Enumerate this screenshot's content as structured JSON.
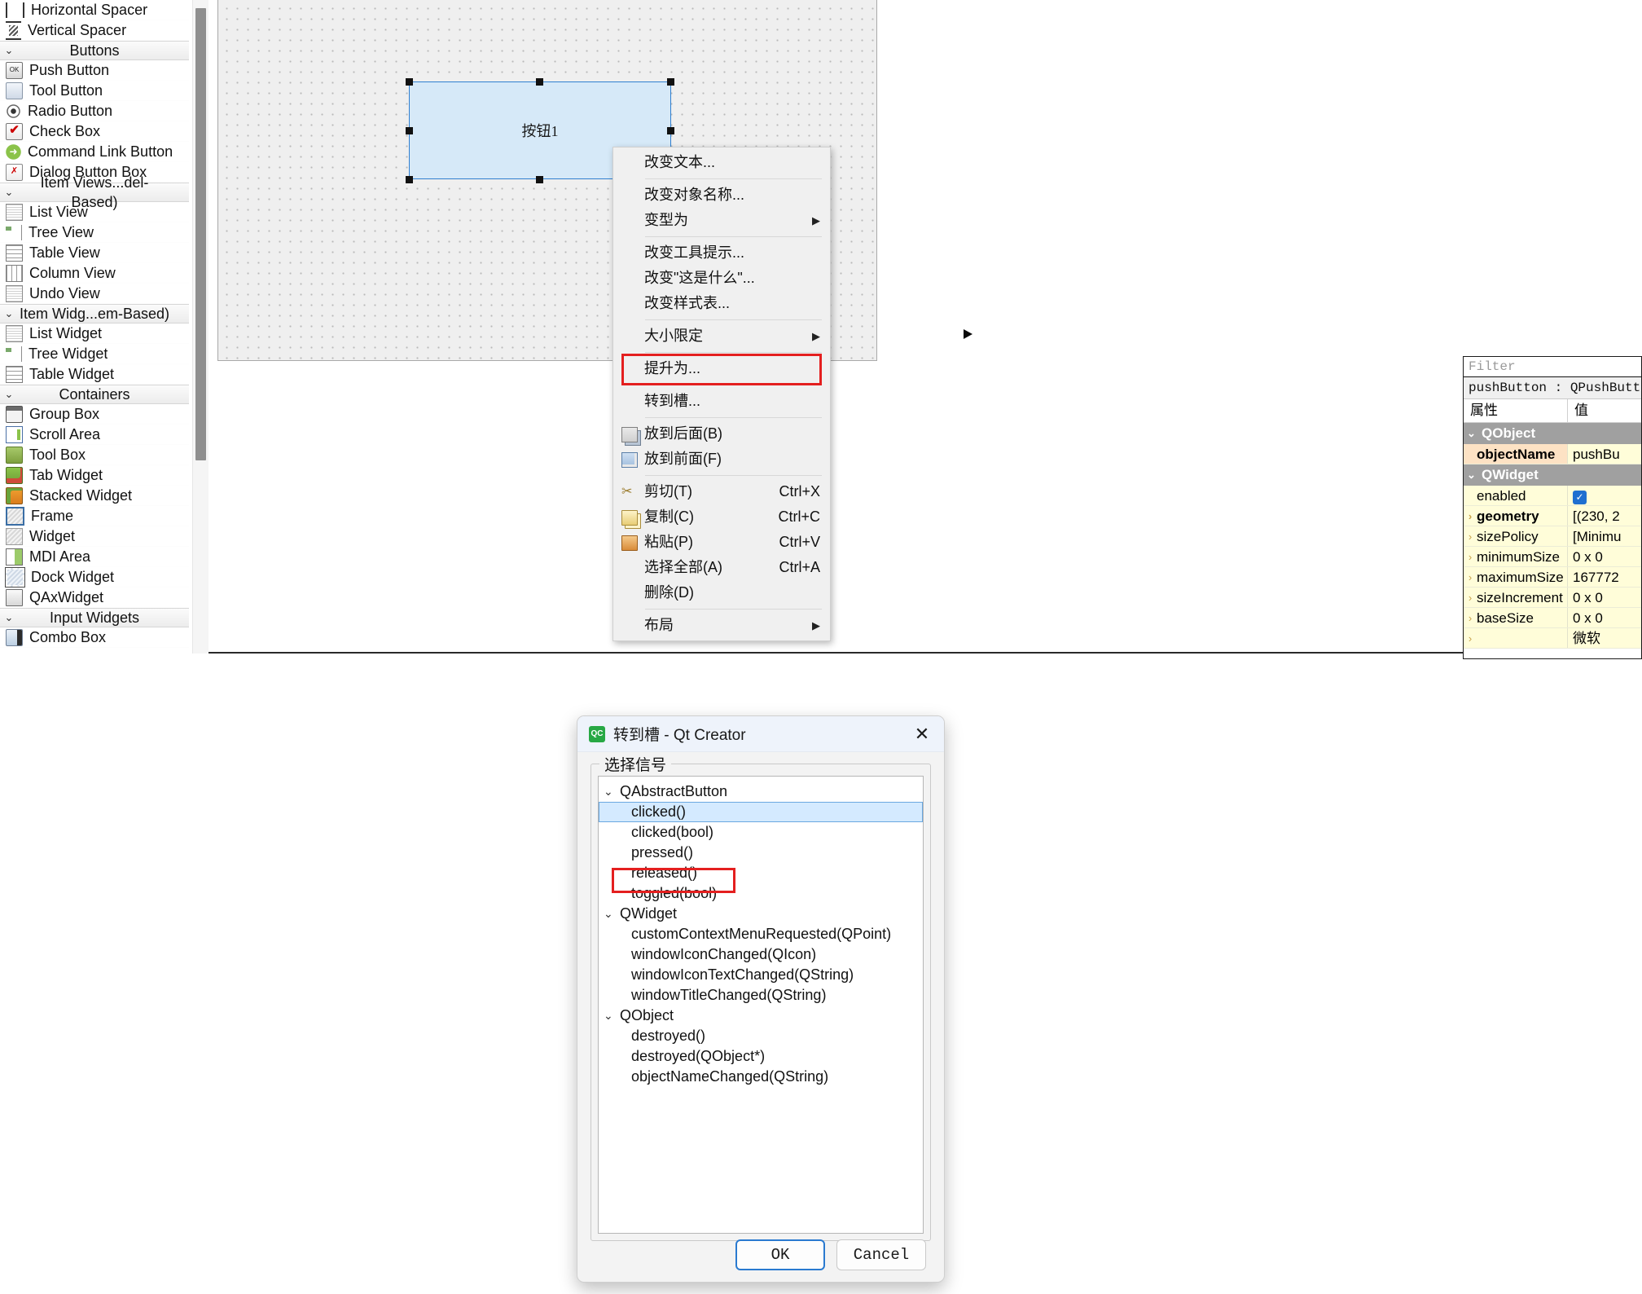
{
  "widget_box": {
    "sections": [
      {
        "type": "item",
        "icon": "horizontal-spacer-icon",
        "icon_class": "ic-hspacer",
        "label": "Horizontal Spacer"
      },
      {
        "type": "item",
        "icon": "vertical-spacer-icon",
        "icon_class": "ic-vspacer",
        "label": "Vertical Spacer"
      },
      {
        "type": "group",
        "label": "Buttons"
      },
      {
        "type": "item",
        "icon": "push-button-icon",
        "icon_class": "ic-push",
        "glyph": "OK",
        "label": "Push Button"
      },
      {
        "type": "item",
        "icon": "tool-button-icon",
        "icon_class": "ic-tool",
        "label": "Tool Button"
      },
      {
        "type": "item",
        "icon": "radio-button-icon",
        "icon_class": "ic-radio",
        "label": "Radio Button"
      },
      {
        "type": "item",
        "icon": "check-box-icon",
        "icon_class": "ic-check",
        "glyph": "✔",
        "label": "Check Box"
      },
      {
        "type": "item",
        "icon": "command-link-button-icon",
        "icon_class": "ic-cmdlink",
        "glyph": "➜",
        "label": "Command Link Button"
      },
      {
        "type": "item",
        "icon": "dialog-button-box-icon",
        "icon_class": "ic-dlgbtn",
        "glyph": "✗",
        "label": "Dialog Button Box"
      },
      {
        "type": "group",
        "label": "Item Views...del-Based)"
      },
      {
        "type": "item",
        "icon": "list-view-icon",
        "icon_class": "ic-listview",
        "label": "List View"
      },
      {
        "type": "item",
        "icon": "tree-view-icon",
        "icon_class": "ic-treeview",
        "label": "Tree View"
      },
      {
        "type": "item",
        "icon": "table-view-icon",
        "icon_class": "ic-tableview",
        "label": "Table View"
      },
      {
        "type": "item",
        "icon": "column-view-icon",
        "icon_class": "ic-columnview",
        "label": "Column View"
      },
      {
        "type": "item",
        "icon": "undo-view-icon",
        "icon_class": "ic-listview",
        "label": "Undo View"
      },
      {
        "type": "group",
        "label": "Item Widg...em-Based)"
      },
      {
        "type": "item",
        "icon": "list-widget-icon",
        "icon_class": "ic-listview",
        "label": "List Widget"
      },
      {
        "type": "item",
        "icon": "tree-widget-icon",
        "icon_class": "ic-treeview",
        "label": "Tree Widget"
      },
      {
        "type": "item",
        "icon": "table-widget-icon",
        "icon_class": "ic-tableview",
        "label": "Table Widget"
      },
      {
        "type": "group",
        "label": "Containers"
      },
      {
        "type": "item",
        "icon": "group-box-icon",
        "icon_class": "ic-groupbox",
        "label": "Group Box"
      },
      {
        "type": "item",
        "icon": "scroll-area-icon",
        "icon_class": "ic-scrollarea",
        "label": "Scroll Area"
      },
      {
        "type": "item",
        "icon": "tool-box-icon",
        "icon_class": "ic-toolbox",
        "label": "Tool Box"
      },
      {
        "type": "item",
        "icon": "tab-widget-icon",
        "icon_class": "ic-tabwidget",
        "label": "Tab Widget"
      },
      {
        "type": "item",
        "icon": "stacked-widget-icon",
        "icon_class": "ic-stacked",
        "label": "Stacked Widget"
      },
      {
        "type": "item",
        "icon": "frame-icon",
        "icon_class": "ic-frame",
        "label": "Frame"
      },
      {
        "type": "item",
        "icon": "widget-icon",
        "icon_class": "ic-widget",
        "label": "Widget"
      },
      {
        "type": "item",
        "icon": "mdi-area-icon",
        "icon_class": "ic-mdi",
        "label": "MDI Area"
      },
      {
        "type": "item",
        "icon": "dock-widget-icon",
        "icon_class": "ic-dock",
        "label": "Dock Widget"
      },
      {
        "type": "item",
        "icon": "qax-widget-icon",
        "icon_class": "ic-qax",
        "label": "QAxWidget"
      },
      {
        "type": "group",
        "label": "Input Widgets"
      },
      {
        "type": "item",
        "icon": "combo-box-icon",
        "icon_class": "ic-combo",
        "label": "Combo Box"
      }
    ]
  },
  "form_editor": {
    "selected_widget_text": "按钮1"
  },
  "context_menu": {
    "items": [
      {
        "label": "改变文本...",
        "icon": "",
        "icon_class": "",
        "shortcut": "",
        "arrow": ""
      },
      {
        "type": "separator"
      },
      {
        "label": "改变对象名称...",
        "icon": "",
        "icon_class": "",
        "shortcut": "",
        "arrow": ""
      },
      {
        "label": "变型为",
        "icon": "",
        "icon_class": "",
        "shortcut": "",
        "arrow": "▶"
      },
      {
        "type": "separator"
      },
      {
        "label": "改变工具提示...",
        "icon": "",
        "icon_class": "",
        "shortcut": "",
        "arrow": ""
      },
      {
        "label": "改变\"这是什么\"...",
        "icon": "",
        "icon_class": "",
        "shortcut": "",
        "arrow": ""
      },
      {
        "label": "改变样式表...",
        "icon": "",
        "icon_class": "",
        "shortcut": "",
        "arrow": ""
      },
      {
        "type": "separator"
      },
      {
        "label": "大小限定",
        "icon": "",
        "icon_class": "",
        "shortcut": "",
        "arrow": "▶"
      },
      {
        "type": "separator"
      },
      {
        "label": "提升为...",
        "icon": "",
        "icon_class": "",
        "shortcut": "",
        "arrow": ""
      },
      {
        "type": "separator"
      },
      {
        "label": "转到槽...",
        "icon": "",
        "icon_class": "",
        "shortcut": "",
        "arrow": ""
      },
      {
        "type": "separator"
      },
      {
        "label": "放到后面(B)",
        "icon": "send-to-back-icon",
        "icon_class": "ci-behind",
        "shortcut": "",
        "arrow": ""
      },
      {
        "label": "放到前面(F)",
        "icon": "bring-to-front-icon",
        "icon_class": "ci-front",
        "shortcut": "",
        "arrow": ""
      },
      {
        "type": "separator"
      },
      {
        "label": "剪切(T)",
        "icon": "scissors-icon",
        "icon_class": "ci-cut",
        "glyph": "✂",
        "shortcut": "Ctrl+X",
        "arrow": ""
      },
      {
        "label": "复制(C)",
        "icon": "copy-icon",
        "icon_class": "ci-copy",
        "shortcut": "Ctrl+C",
        "arrow": ""
      },
      {
        "label": "粘贴(P)",
        "icon": "paste-icon",
        "icon_class": "ci-paste",
        "shortcut": "Ctrl+V",
        "arrow": ""
      },
      {
        "label": "选择全部(A)",
        "icon": "",
        "icon_class": "",
        "shortcut": "Ctrl+A",
        "arrow": ""
      },
      {
        "label": "删除(D)",
        "icon": "",
        "icon_class": "",
        "shortcut": "",
        "arrow": ""
      },
      {
        "type": "separator"
      },
      {
        "label": "布局",
        "icon": "",
        "icon_class": "",
        "shortcut": "",
        "arrow": "▶"
      }
    ],
    "highlighted_item": "转到槽...",
    "highlight_color": "#e41f1f"
  },
  "property_editor": {
    "filter_placeholder": "Filter",
    "object_header": "pushButton : QPushButton",
    "columns": {
      "name": "属性",
      "value": "值"
    },
    "rows": [
      {
        "kind": "group",
        "name": "QObject"
      },
      {
        "kind": "prop",
        "name": "objectName",
        "value": "pushBu",
        "style": "orange",
        "bold": true,
        "expander": ""
      },
      {
        "kind": "group",
        "name": "QWidget"
      },
      {
        "kind": "prop",
        "name": "enabled",
        "value": "",
        "style": "yellow",
        "bold": false,
        "expander": "",
        "checkbox": true
      },
      {
        "kind": "prop",
        "name": "geometry",
        "value": "[(230, 2",
        "style": "yellow",
        "bold": true,
        "expander": "›"
      },
      {
        "kind": "prop",
        "name": "sizePolicy",
        "value": "[Minimu",
        "style": "yellow",
        "bold": false,
        "expander": "›"
      },
      {
        "kind": "prop",
        "name": "minimumSize",
        "value": "0 x 0",
        "style": "yellow",
        "bold": false,
        "expander": "›"
      },
      {
        "kind": "prop",
        "name": "maximumSize",
        "value": "167772",
        "style": "yellow",
        "bold": false,
        "expander": "›"
      },
      {
        "kind": "prop",
        "name": "sizeIncrement",
        "value": "0 x 0",
        "style": "yellow",
        "bold": false,
        "expander": "›"
      },
      {
        "kind": "prop",
        "name": "baseSize",
        "value": "0 x 0",
        "style": "yellow",
        "bold": false,
        "expander": "›"
      },
      {
        "kind": "prop",
        "name": "",
        "value": "微软",
        "style": "yellow",
        "bold": false,
        "expander": "›"
      }
    ]
  },
  "goto_slot_dialog": {
    "app_icon_text": "QC",
    "title": "转到槽 - Qt Creator",
    "close_label": "✕",
    "group_title": "选择信号",
    "tree": [
      {
        "kind": "group",
        "label": "QAbstractButton",
        "chevron": "⌄"
      },
      {
        "kind": "leaf",
        "label": "clicked()",
        "selected": true
      },
      {
        "kind": "leaf",
        "label": "clicked(bool)",
        "selected": false
      },
      {
        "kind": "leaf",
        "label": "pressed()",
        "selected": false
      },
      {
        "kind": "leaf",
        "label": "released()",
        "selected": false
      },
      {
        "kind": "leaf",
        "label": "toggled(bool)",
        "selected": false
      },
      {
        "kind": "group",
        "label": "QWidget",
        "chevron": "⌄"
      },
      {
        "kind": "leaf",
        "label": "customContextMenuRequested(QPoint)",
        "selected": false
      },
      {
        "kind": "leaf",
        "label": "windowIconChanged(QIcon)",
        "selected": false
      },
      {
        "kind": "leaf",
        "label": "windowIconTextChanged(QString)",
        "selected": false
      },
      {
        "kind": "leaf",
        "label": "windowTitleChanged(QString)",
        "selected": false
      },
      {
        "kind": "group",
        "label": "QObject",
        "chevron": "⌄"
      },
      {
        "kind": "leaf",
        "label": "destroyed()",
        "selected": false
      },
      {
        "kind": "leaf",
        "label": "destroyed(QObject*)",
        "selected": false
      },
      {
        "kind": "leaf",
        "label": "objectNameChanged(QString)",
        "selected": false
      }
    ],
    "ok_label": "OK",
    "cancel_label": "Cancel",
    "highlight_color": "#e41f1f"
  }
}
